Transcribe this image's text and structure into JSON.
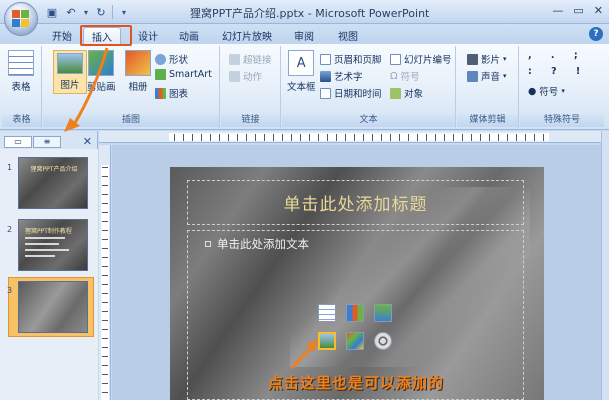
{
  "window": {
    "title": "狸窝PPT产品介绍.pptx - Microsoft PowerPoint",
    "minimize_icon": "minimize-icon",
    "maximize_icon": "maximize-icon",
    "close_icon": "close-icon"
  },
  "quick_access": [
    "save-icon",
    "undo-icon",
    "redo-icon"
  ],
  "tabs": [
    {
      "label": "开始"
    },
    {
      "label": "插入",
      "active": true
    },
    {
      "label": "设计"
    },
    {
      "label": "动画"
    },
    {
      "label": "幻灯片放映"
    },
    {
      "label": "审阅"
    },
    {
      "label": "视图"
    }
  ],
  "ribbon": {
    "table_group": {
      "label": "表格",
      "table_btn": "表格"
    },
    "images_group": {
      "label": "插图",
      "picture_btn": "图片",
      "clipart_btn": "剪贴画",
      "album_btn": "相册",
      "shapes_btn": "形状",
      "smartart_btn": "SmartArt",
      "chart_btn": "图表"
    },
    "links_group": {
      "label": "链接",
      "hyperlink_btn": "超链接",
      "action_btn": "动作"
    },
    "text_group": {
      "label": "文本",
      "textbox_btn": "文本框",
      "header_footer_btn": "页眉和页脚",
      "wordart_btn": "艺术字",
      "datetime_btn": "日期和时间",
      "slide_number_btn": "幻灯片编号",
      "symbol_btn": "符号",
      "object_btn": "对象"
    },
    "media_group": {
      "label": "媒体剪辑",
      "movie_btn": "影片",
      "sound_btn": "声音"
    },
    "special_group": {
      "label": "特殊符号",
      "symbol_btn": "符号"
    }
  },
  "slides_panel": {
    "slides": [
      {
        "number": "1",
        "title": "狸窝PPT产品介绍"
      },
      {
        "number": "2",
        "title": "狸窝PPT制作教程"
      },
      {
        "number": "3",
        "title": "",
        "selected": true
      }
    ]
  },
  "slide": {
    "title_placeholder": "单击此处添加标题",
    "body_placeholder": "单击此处添加文本",
    "annotation": "点击这里也是可以添加的"
  },
  "colors": {
    "accent": "#e2541e",
    "annotation": "#f07f1e",
    "title_text": "#e8d898"
  }
}
